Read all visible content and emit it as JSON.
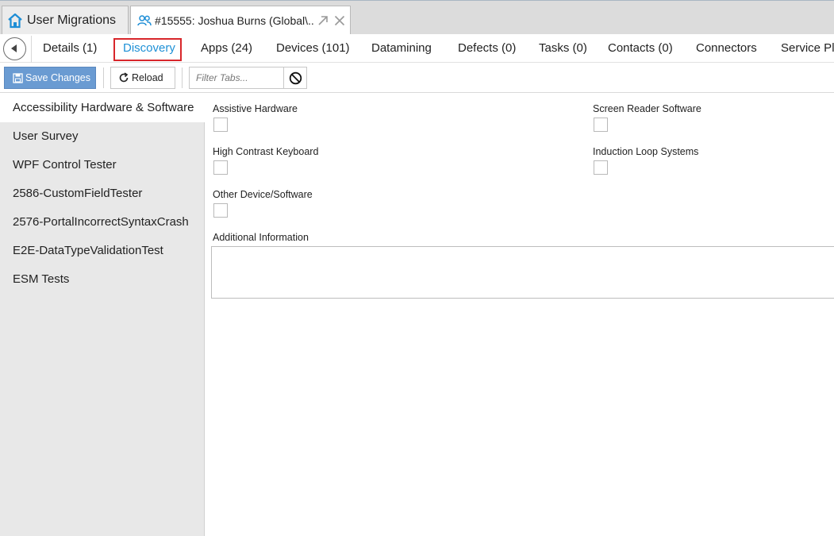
{
  "window_tabs": [
    {
      "label": "User Migrations",
      "icon": "home-icon"
    },
    {
      "label": "#15555: Joshua Burns (Global\\...",
      "icon": "users-icon",
      "actions": [
        "popout-icon",
        "close-icon"
      ]
    }
  ],
  "nav": {
    "back_icon": "chevron-left-icon",
    "tabs": [
      "Details (1)",
      "Discovery",
      "Apps (24)",
      "Devices (101)",
      "Datamining",
      "Defects (0)",
      "Tasks (0)",
      "Contacts (0)",
      "Connectors",
      "Service Pla"
    ],
    "selected": "Discovery"
  },
  "toolbar": {
    "save_label": "Save Changes",
    "reload_label": "Reload",
    "filter_placeholder": "Filter Tabs...",
    "clear_icon": "no-entry-icon"
  },
  "sidebar": {
    "items": [
      "Accessibility Hardware & Software",
      "User Survey",
      "WPF Control Tester",
      "2586-CustomFieldTester",
      "2576-PortalIncorrectSyntaxCrash",
      "E2E-DataTypeValidationTest",
      "ESM Tests"
    ],
    "selected": "Accessibility Hardware & Software"
  },
  "form": {
    "assistive_hardware": {
      "label": "Assistive Hardware",
      "checked": false
    },
    "screen_reader_software": {
      "label": "Screen Reader Software",
      "checked": false
    },
    "high_contrast_keyboard": {
      "label": "High Contrast Keyboard",
      "checked": false
    },
    "induction_loop_systems": {
      "label": "Induction Loop Systems",
      "checked": false
    },
    "other_device_software": {
      "label": "Other Device/Software",
      "checked": false
    },
    "additional_information": {
      "label": "Additional Information",
      "value": ""
    }
  },
  "colors": {
    "accent": "#1e90d6",
    "save_button": "#6a9bd2",
    "focus_outline": "#d8262b",
    "sidebar_bg": "#e8e8e8"
  }
}
